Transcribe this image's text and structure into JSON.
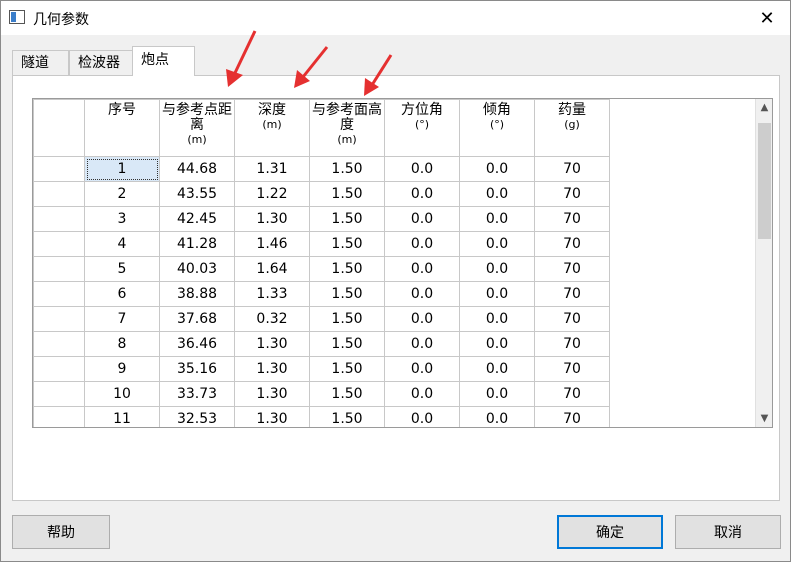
{
  "window": {
    "title": "几何参数",
    "close_glyph": "✕"
  },
  "tabs": [
    {
      "label": "隧道",
      "active": false
    },
    {
      "label": "检波器",
      "active": false
    },
    {
      "label": "炮点",
      "active": true
    }
  ],
  "table": {
    "headers": [
      {
        "label": "序号",
        "unit": ""
      },
      {
        "label": "与参考点距离",
        "unit": "(m)"
      },
      {
        "label": "深度",
        "unit": "(m)"
      },
      {
        "label": "与参考面高度",
        "unit": "(m)"
      },
      {
        "label": "方位角",
        "unit": "(°)"
      },
      {
        "label": "倾角",
        "unit": "(°)"
      },
      {
        "label": "药量",
        "unit": "(g)"
      }
    ],
    "rows": [
      [
        "1",
        "44.68",
        "1.31",
        "1.50",
        "0.0",
        "0.0",
        "70"
      ],
      [
        "2",
        "43.55",
        "1.22",
        "1.50",
        "0.0",
        "0.0",
        "70"
      ],
      [
        "3",
        "42.45",
        "1.30",
        "1.50",
        "0.0",
        "0.0",
        "70"
      ],
      [
        "4",
        "41.28",
        "1.46",
        "1.50",
        "0.0",
        "0.0",
        "70"
      ],
      [
        "5",
        "40.03",
        "1.64",
        "1.50",
        "0.0",
        "0.0",
        "70"
      ],
      [
        "6",
        "38.88",
        "1.33",
        "1.50",
        "0.0",
        "0.0",
        "70"
      ],
      [
        "7",
        "37.68",
        "0.32",
        "1.50",
        "0.0",
        "0.0",
        "70"
      ],
      [
        "8",
        "36.46",
        "1.30",
        "1.50",
        "0.0",
        "0.0",
        "70"
      ],
      [
        "9",
        "35.16",
        "1.30",
        "1.50",
        "0.0",
        "0.0",
        "70"
      ],
      [
        "10",
        "33.73",
        "1.30",
        "1.50",
        "0.0",
        "0.0",
        "70"
      ],
      [
        "11",
        "32.53",
        "1.30",
        "1.50",
        "0.0",
        "0.0",
        "70"
      ]
    ]
  },
  "scrollbar": {
    "up_glyph": "▲",
    "down_glyph": "▼"
  },
  "buttons": {
    "help": "帮助",
    "ok": "确定",
    "cancel": "取消"
  },
  "colors": {
    "accent": "#0078d7",
    "annotation_arrow": "#e53030",
    "selected_cell": "#d9e8f7"
  }
}
